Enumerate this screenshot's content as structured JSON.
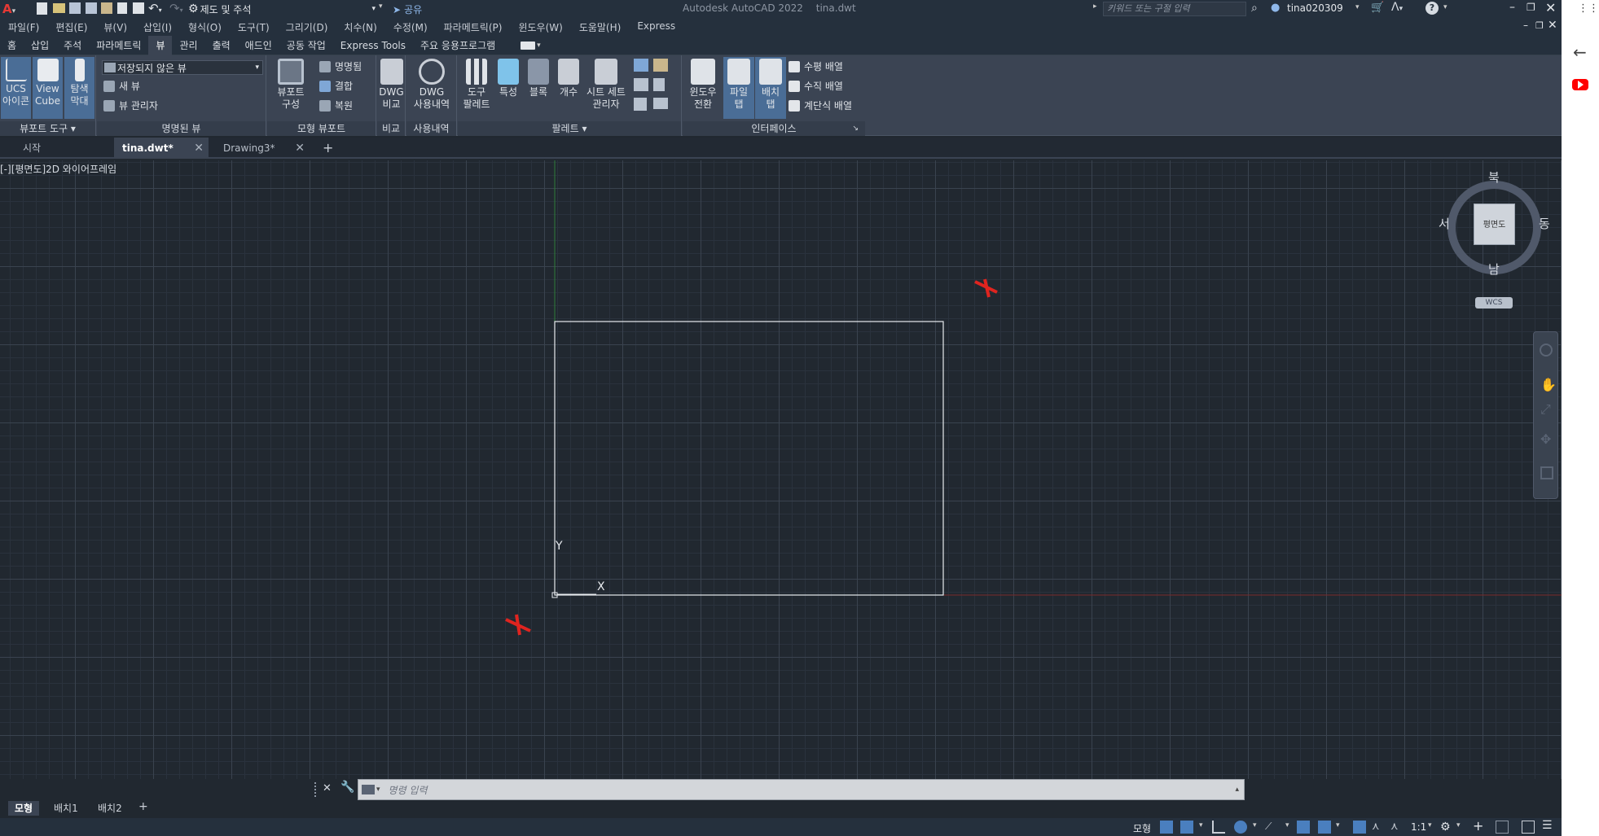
{
  "titlebar": {
    "app_title": "Autodesk AutoCAD 2022",
    "file_name": "tina.dwt",
    "workspace": "제도 및 주석",
    "share_label": "공유",
    "search_placeholder": "키워드 또는 구절 입력",
    "user": "tina020309"
  },
  "menubar": [
    "파일(F)",
    "편집(E)",
    "뷰(V)",
    "삽입(I)",
    "형식(O)",
    "도구(T)",
    "그리기(D)",
    "치수(N)",
    "수정(M)",
    "파라메트릭(P)",
    "윈도우(W)",
    "도움말(H)",
    "Express"
  ],
  "ribbon_tabs": [
    "홈",
    "삽입",
    "주석",
    "파라메트릭",
    "뷰",
    "관리",
    "출력",
    "애드인",
    "공동 작업",
    "Express Tools",
    "주요 응용프로그램"
  ],
  "ribbon_active": "뷰",
  "ribbon": {
    "viewport_tools": {
      "title": "뷰포트 도구",
      "ucs": "UCS\n아이콘",
      "viewcube": "View\nCube",
      "nav": "탐색\n막대"
    },
    "named_views": {
      "title": "명명된 뷰",
      "dropdown": "저장되지 않은 뷰",
      "new_view": "새 뷰",
      "view_manager": "뷰 관리자"
    },
    "model_viewports": {
      "title": "모형 뷰포트",
      "config": "뷰포트\n구성",
      "named": "명명됨",
      "join": "결합",
      "restore": "복원"
    },
    "compare": {
      "title": "비교",
      "dwg_compare": "DWG\n비교"
    },
    "history": {
      "title": "사용내역",
      "dwg_history": "DWG\n사용내역"
    },
    "palettes": {
      "title": "팔레트",
      "tool_palette": "도구\n팔레트",
      "properties": "특성",
      "block": "블록",
      "count": "개수",
      "sheet_set": "시트 세트\n관리자"
    },
    "interface": {
      "title": "인터페이스",
      "switch_window": "윈도우\n전환",
      "file_tab": "파일\n탭",
      "layout_tab": "배치\n탭",
      "tile_h": "수평 배열",
      "tile_v": "수직 배열",
      "cascade": "계단식 배열"
    }
  },
  "doc_tabs": [
    "시작",
    "tina.dwt*",
    "Drawing3*"
  ],
  "viewport_label": "[-][평면도]2D 와이어프레임",
  "viewcube": {
    "north": "북",
    "south": "남",
    "east": "동",
    "west": "서",
    "face": "평면도",
    "wcs": "WCS"
  },
  "ucs": {
    "x": "X",
    "y": "Y"
  },
  "command": {
    "placeholder": "명령 입력"
  },
  "layout_tabs": [
    "모형",
    "배치1",
    "배치2"
  ],
  "status": {
    "model": "모형",
    "scale": "1:1"
  }
}
